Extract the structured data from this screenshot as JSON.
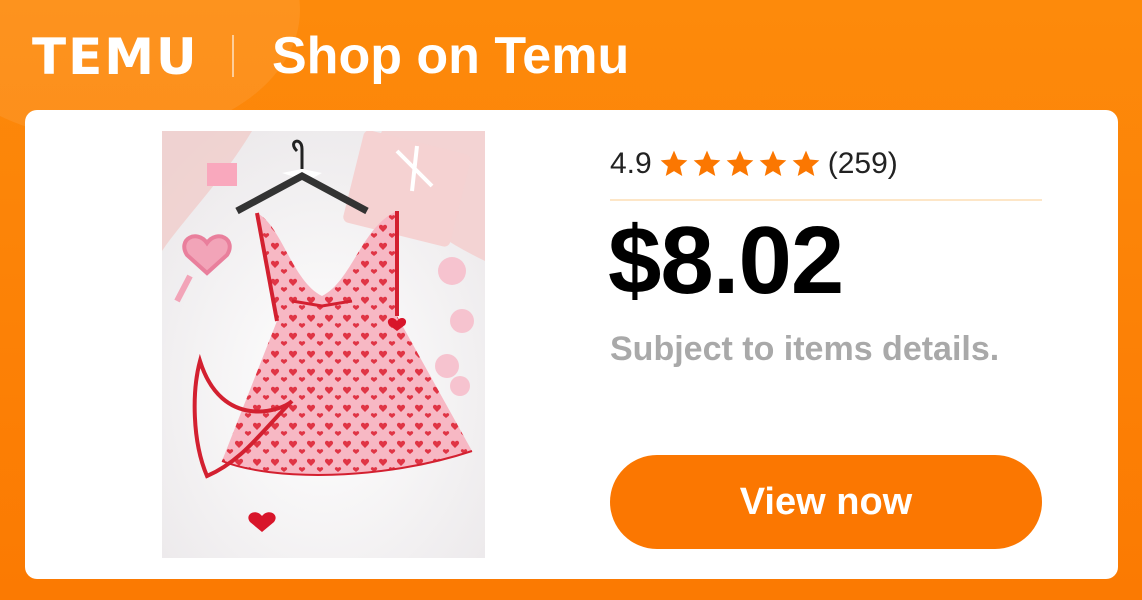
{
  "header": {
    "logo_text": "TEMU",
    "title": "Shop on Temu"
  },
  "product": {
    "image_icon": "product-photo-pink-heart-nightdress",
    "rating": "4.9",
    "star_count": 5,
    "review_count": "(259)",
    "price": "$8.02",
    "subject_note": "Subject to items details."
  },
  "cta": {
    "label": "View now"
  },
  "colors": {
    "brand_orange": "#fb7701",
    "star_orange": "#fb7701",
    "price_text": "#000000",
    "muted_text": "#a9a9a9"
  }
}
